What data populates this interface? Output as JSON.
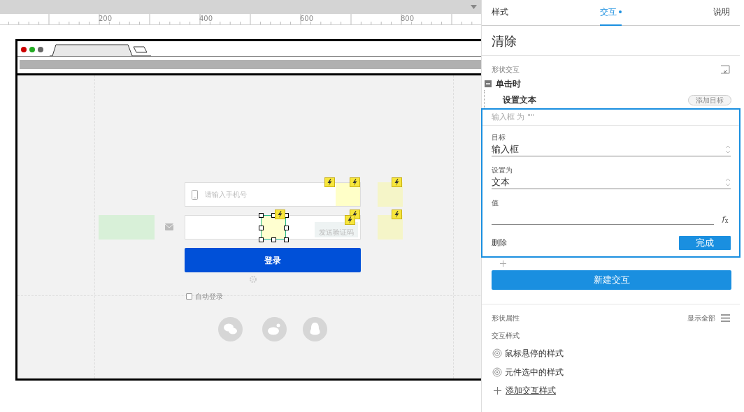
{
  "ruler": {
    "ticks": [
      "200",
      "400",
      "600",
      "800"
    ]
  },
  "mockup": {
    "phone_placeholder": "请输入手机号",
    "code_button": "发送验证码",
    "login_button": "登录",
    "remember": {
      "label": "自动登录",
      "checked": false
    }
  },
  "panel": {
    "tabs": [
      {
        "label": "样式",
        "selected": false,
        "dot": false
      },
      {
        "label": "交互",
        "selected": true,
        "dot": true
      },
      {
        "label": "说明",
        "selected": false,
        "dot": false
      }
    ],
    "title": "清除",
    "section": "形状交互",
    "event": {
      "label": "单击时",
      "expanded": true
    },
    "action": {
      "label": "设置文本",
      "add_target": "添加目标",
      "summary": "输入框 为 \"\"",
      "fields": [
        {
          "kind": "select",
          "label": "目标",
          "value": "输入框"
        },
        {
          "kind": "select",
          "label": "设置为",
          "value": "文本"
        },
        {
          "kind": "formula",
          "label": "值",
          "icon_text": "*f*$_{x}$"
        }
      ],
      "delete": "删除",
      "done": "完成"
    },
    "new_interaction": "新建交互",
    "properties": {
      "title": "形状属性",
      "show_all": "显示全部",
      "subtitle": "交互样式",
      "styles": [
        "鼠标悬停的样式",
        "元件选中的样式"
      ],
      "add_style": "添加交互样式"
    }
  }
}
